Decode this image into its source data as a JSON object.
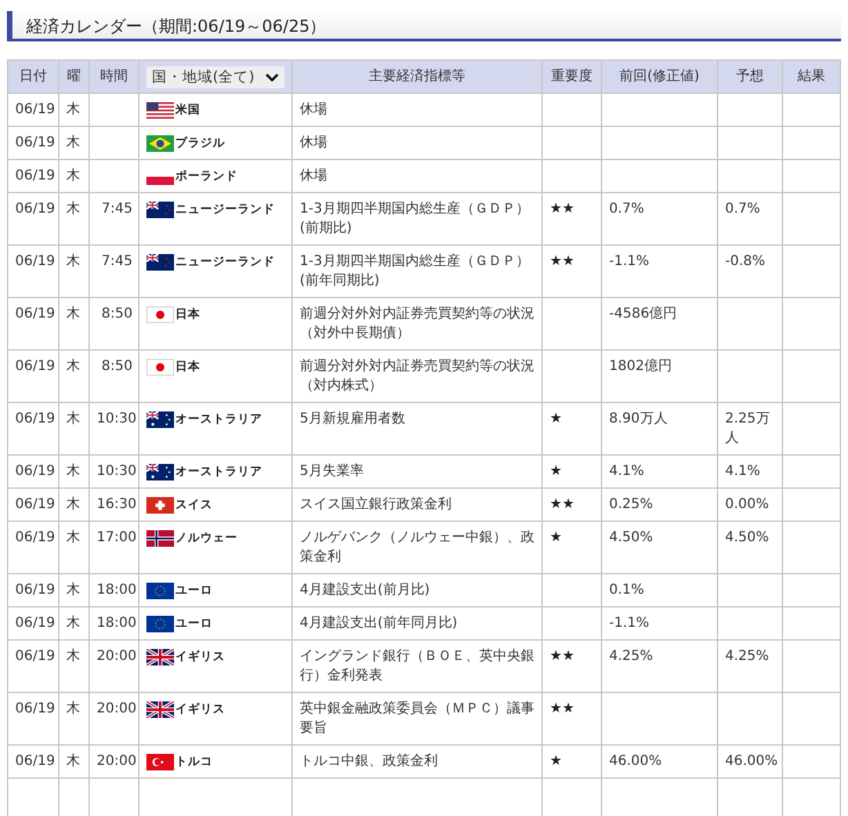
{
  "title": "経済カレンダー（期間:06/19～06/25）",
  "columns": {
    "date": "日付",
    "weekday": "曜",
    "time": "時間",
    "region_filter": "国・地域(全て)",
    "indicator": "主要経済指標等",
    "importance": "重要度",
    "previous": "前回(修正値)",
    "forecast": "予想",
    "result": "結果"
  },
  "rows": [
    {
      "date": "06/19",
      "weekday": "木",
      "flag": {
        "kind": "us"
      },
      "country": "米国",
      "indicator": "休場"
    },
    {
      "date": "06/19",
      "weekday": "木",
      "flag": {
        "kind": "br"
      },
      "country": "ブラジル",
      "indicator": "休場"
    },
    {
      "date": "06/19",
      "weekday": "木",
      "flag": {
        "kind": "pl"
      },
      "country": "ポーランド",
      "indicator": "休場"
    },
    {
      "date": "06/19",
      "weekday": "木",
      "time": "7:45",
      "flag": {
        "kind": "nz"
      },
      "country": "ニュージーランド",
      "indicator": "1-3月期四半期国内総生産（ＧＤＰ）(前期比)",
      "importance": "★★",
      "previous": "0.7%",
      "forecast": "0.7%"
    },
    {
      "date": "06/19",
      "weekday": "木",
      "time": "7:45",
      "flag": {
        "kind": "nz"
      },
      "country": "ニュージーランド",
      "indicator": "1-3月期四半期国内総生産（ＧＤＰ）(前年同期比)",
      "importance": "★★",
      "previous": "-1.1%",
      "forecast": "-0.8%"
    },
    {
      "date": "06/19",
      "weekday": "木",
      "time": "8:50",
      "flag": {
        "kind": "jp"
      },
      "country": "日本",
      "indicator": "前週分対外対内証券売買契約等の状況（対外中長期債）",
      "previous": "-4586億円"
    },
    {
      "date": "06/19",
      "weekday": "木",
      "time": "8:50",
      "flag": {
        "kind": "jp"
      },
      "country": "日本",
      "indicator": "前週分対外対内証券売買契約等の状況（対内株式）",
      "previous": "1802億円"
    },
    {
      "date": "06/19",
      "weekday": "木",
      "time": "10:30",
      "flag": {
        "kind": "au"
      },
      "country": "オーストラリア",
      "indicator": "5月新規雇用者数",
      "importance": "★",
      "previous": "8.90万人",
      "forecast": "2.25万人"
    },
    {
      "date": "06/19",
      "weekday": "木",
      "time": "10:30",
      "flag": {
        "kind": "au"
      },
      "country": "オーストラリア",
      "indicator": "5月失業率",
      "importance": "★",
      "previous": "4.1%",
      "forecast": "4.1%"
    },
    {
      "date": "06/19",
      "weekday": "木",
      "time": "16:30",
      "flag": {
        "kind": "ch"
      },
      "country": "スイス",
      "indicator": "スイス国立銀行政策金利",
      "importance": "★★",
      "previous": "0.25%",
      "forecast": "0.00%"
    },
    {
      "date": "06/19",
      "weekday": "木",
      "time": "17:00",
      "flag": {
        "kind": "no"
      },
      "country": "ノルウェー",
      "indicator": "ノルゲバンク（ノルウェー中銀）、政策金利",
      "importance": "★",
      "previous": "4.50%",
      "forecast": "4.50%"
    },
    {
      "date": "06/19",
      "weekday": "木",
      "time": "18:00",
      "flag": {
        "kind": "eu"
      },
      "country": "ユーロ",
      "indicator": "4月建設支出(前月比)",
      "previous": "0.1%"
    },
    {
      "date": "06/19",
      "weekday": "木",
      "time": "18:00",
      "flag": {
        "kind": "eu"
      },
      "country": "ユーロ",
      "indicator": "4月建設支出(前年同月比)",
      "previous": "-1.1%"
    },
    {
      "date": "06/19",
      "weekday": "木",
      "time": "20:00",
      "flag": {
        "kind": "gb"
      },
      "country": "イギリス",
      "indicator": "イングランド銀行（ＢＯＥ、英中央銀行）金利発表",
      "importance": "★★",
      "previous": "4.25%",
      "forecast": "4.25%"
    },
    {
      "date": "06/19",
      "weekday": "木",
      "time": "20:00",
      "flag": {
        "kind": "gb"
      },
      "country": "イギリス",
      "indicator": "英中銀金融政策委員会（ＭＰＣ）議事要旨",
      "importance": "★★"
    },
    {
      "date": "06/19",
      "weekday": "木",
      "time": "20:00",
      "flag": {
        "kind": "tr"
      },
      "country": "トルコ",
      "indicator": "トルコ中銀、政策金利",
      "importance": "★",
      "previous": "46.00%",
      "forecast": "46.00%"
    }
  ]
}
